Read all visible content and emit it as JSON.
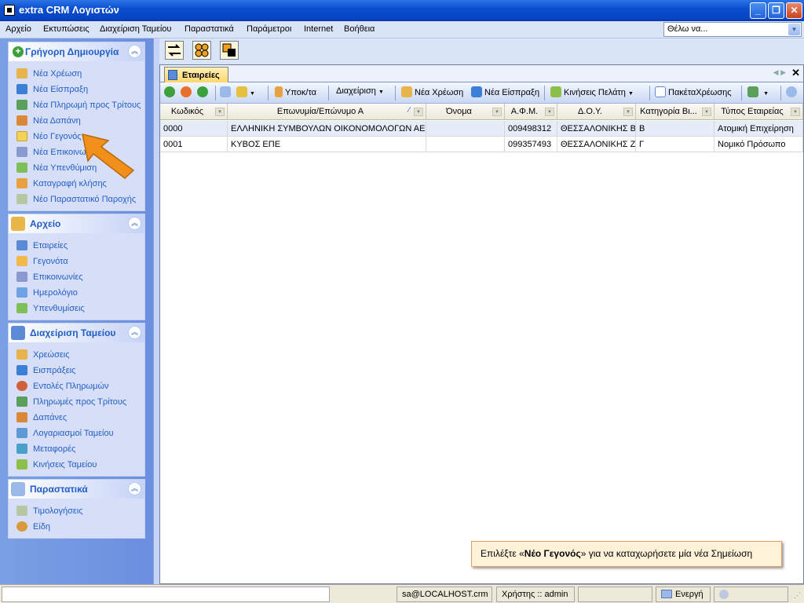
{
  "window": {
    "title": "extra CRM Λογιστών"
  },
  "menu": {
    "items": [
      "Αρχείο",
      "Εκτυπώσεις",
      "Διαχείριση Ταμείου",
      "Παραστατικά",
      "Παράμετροι",
      "Internet",
      "Βοήθεια"
    ],
    "search_value": "Θέλω να..."
  },
  "sidebar": {
    "groups": [
      {
        "title": "Γρήγορη Δημιουργία",
        "items": [
          "Νέα Χρέωση",
          "Νέα Είσπραξη",
          "Νέα Πληρωμή προς Τρίτους",
          "Νέα Δαπάνη",
          "Νέο Γεγονός",
          "Νέα Επικοινωνία",
          "Νέα Υπενθύμιση",
          "Καταγραφή κλήσης",
          "Νέο Παραστατικό Παροχής"
        ]
      },
      {
        "title": "Αρχείο",
        "items": [
          "Εταιρείες",
          "Γεγονότα",
          "Επικοινωνίες",
          "Ημερολόγιο",
          "Υπενθυμίσεις"
        ]
      },
      {
        "title": "Διαχείριση Ταμείου",
        "items": [
          "Χρεώσεις",
          "Εισπράξεις",
          "Εντολές Πληρωμών",
          "Πληρωμές προς Τρίτους",
          "Δαπάνες",
          "Λογαριασμοί Ταμείου",
          "Μεταφορές",
          "Κινήσεις Ταμείου"
        ]
      },
      {
        "title": "Παραστατικά",
        "items": [
          "Τιμολογήσεις",
          "Είδη"
        ]
      }
    ]
  },
  "tab": {
    "label": "Εταιρείες"
  },
  "toolbar": {
    "subcat": "Υποκ/τα",
    "manage": "Διαχείριση",
    "new_charge": "Νέα Χρέωση",
    "new_receipt": "Νέα Είσπραξη",
    "client_moves": "Κινήσεις Πελάτη",
    "charge_packages": "ΠακέταΧρέωσης"
  },
  "grid": {
    "columns": [
      "Κωδικός",
      "Επωνυμία/Επώνυμο Α",
      "Όνομα",
      "Α.Φ.Μ.",
      "Δ.Ο.Υ.",
      "Κατηγορία Βι...",
      "Τύπος Εταιρείας"
    ],
    "rows": [
      [
        "0000",
        "ΕΛΛΗΝΙΚΗ ΣΥΜΒΟΥΛΩΝ ΟΙΚΟΝΟΜΟΛΟΓΩΝ ΑΕ",
        "",
        "009498312",
        "ΘΕΣΣΑΛΟΝΙΚΗΣ Β'",
        "Β",
        "Ατομική Επιχείρηση"
      ],
      [
        "0001",
        "ΚΥΒΟΣ ΕΠΕ",
        "",
        "099357493",
        "ΘΕΣΣΑΛΟΝΙΚΗΣ Ζ'",
        "Γ",
        "Νομικό Πρόσωπο"
      ]
    ]
  },
  "hint": {
    "prefix": "Επιλέξτε «",
    "bold": "Νέο Γεγονός",
    "suffix": "» για να καταχωρήσετε μία νέα Σημείωση"
  },
  "status": {
    "server": "sa@LOCALHOST.crm",
    "user": "Χρήστης :: admin",
    "state": "Ενεργή"
  },
  "colors": {
    "titlebar": "#0a4fd0",
    "sidebar_link": "#215dc6",
    "arrow": "#f0901a",
    "hint_bg": "#fff2d9"
  }
}
